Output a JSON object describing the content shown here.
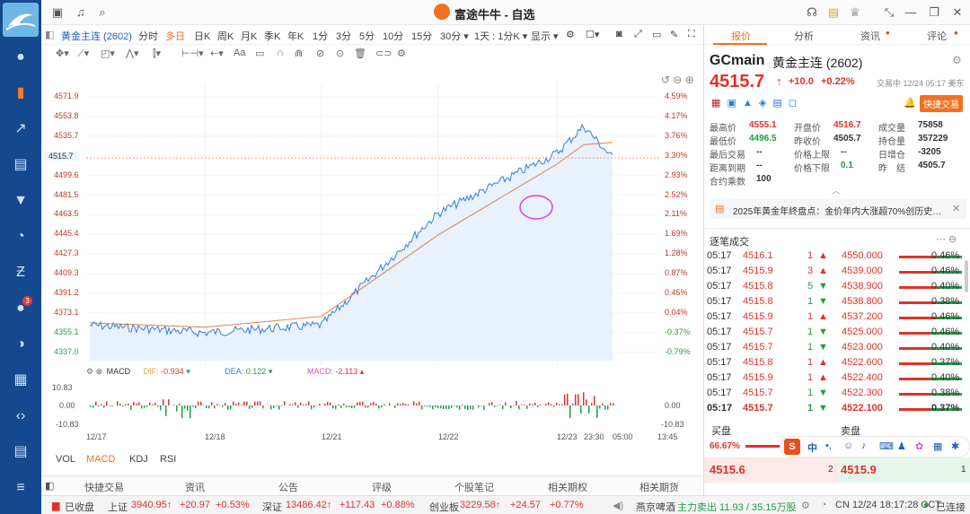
{
  "app": {
    "title": "富途牛牛 - 自选"
  },
  "sidebar": {
    "items": [
      "user-icon",
      "quote-icon",
      "chart-icon",
      "portfolio-icon",
      "market-icon",
      "pie-icon",
      "futures-icon",
      "message-icon",
      "news-icon",
      "game-icon",
      "code-icon",
      "doc-icon",
      "menu-icon"
    ],
    "badge": "3"
  },
  "toolbar": {
    "symbol": "黄金主连 (2602)",
    "periods": [
      "分时",
      "多日",
      "日K",
      "周K",
      "月K",
      "季K",
      "年K",
      "1分",
      "3分",
      "5分",
      "10分",
      "15分",
      "30分 ▾",
      "1天 : 1分K ▾",
      "显示 ▾"
    ],
    "active_period": "多日"
  },
  "chart": {
    "y_labels": [
      "4571.9",
      "4553.8",
      "4535.7",
      "4517.6",
      "4499.6",
      "4481.5",
      "4463.5",
      "4445.4",
      "4427.3",
      "4409.3",
      "4391.2",
      "4373.1",
      "4355.1",
      "4337.0"
    ],
    "pct_labels": [
      "4.59%",
      "4.17%",
      "3.76%",
      "3.30%",
      "2.93%",
      "2.52%",
      "2.11%",
      "1.69%",
      "1.28%",
      "0.87%",
      "0.45%",
      "0.04%",
      "-0.37%",
      "-0.79%"
    ],
    "current_price_label": "4515.7",
    "x_labels": [
      "12/17",
      "12/18",
      "12/21",
      "12/22",
      "12/23",
      "23:30",
      "05:00",
      "13:45"
    ]
  },
  "chart_data": {
    "type": "line",
    "title": "",
    "ylim": [
      4337.0,
      4571.9
    ],
    "series": [
      {
        "name": "",
        "x": [
          "12/17",
          "12/18",
          "12/21",
          "12/22",
          "12/23",
          "23:30",
          "05:00"
        ],
        "values": [
          4362,
          4355,
          4362,
          4465,
          4520,
          4545,
          4515.7
        ]
      },
      {
        "name": "",
        "x": [
          "12/17",
          "12/18",
          "12/21",
          "12/22",
          "12/23",
          "23:30",
          "05:00"
        ],
        "values": [
          4364,
          4360,
          4370,
          4445,
          4510,
          4528,
          4530
        ]
      }
    ]
  },
  "macd": {
    "label": "MACD",
    "dif_label": "DIF:",
    "dif": "-0.934",
    "dea_label": "DEA:",
    "dea": "0.122",
    "macd_label": "MACD:",
    "macd": "-2.113",
    "top": "10.83",
    "zero": "0.00",
    "bottom": "-10.83"
  },
  "indicators": [
    "VOL",
    "MACD",
    "KDJ",
    "RSI"
  ],
  "bottom_tabs": [
    "快捷交易",
    "资讯",
    "公告",
    "评级",
    "个股笔记",
    "相关期权",
    "相关期货"
  ],
  "status": {
    "closed": "已收盘",
    "idx1": {
      "name": "上证",
      "val": "3940.95↑",
      "chg": "+20.97",
      "pct": "+0.53%"
    },
    "idx2": {
      "name": "深证",
      "val": "13486.42↑",
      "chg": "+117.43",
      "pct": "+0.88%"
    },
    "idx3": {
      "name": "创业板",
      "val": "3229.58↑",
      "chg": "+24.57",
      "pct": "+0.77%"
    },
    "stock": "燕京啤酒",
    "flow": "主力卖出 11.93 / 35.15万股",
    "time": "CN 12/24 18:17:28 CCT",
    "conn": "已连接"
  },
  "right": {
    "tabs": [
      "报价",
      "分析",
      "资讯",
      "评论"
    ],
    "code": "GCmain",
    "name": "黄金主连 (2602)",
    "price": "4515.7",
    "arrow": "↑",
    "chg": "+10.0",
    "pct": "+0.22%",
    "trade_time": "交易中 12/24 05:17 美东",
    "quick_trade": "快捷交易",
    "stats": [
      [
        "最高价",
        "4555.1",
        "开盘价",
        "4516.7",
        "成交量",
        "75858"
      ],
      [
        "最低价",
        "4496.5",
        "昨收价",
        "4505.7",
        "持仓量",
        "357229"
      ],
      [
        "最后交易",
        "--",
        "价格上限",
        "--",
        "日增仓",
        "-3205"
      ],
      [
        "距离到期",
        "--",
        "价格下限",
        "0.1",
        "昨　结",
        "4505.7"
      ],
      [
        "合约乘数",
        "100",
        "",
        "",
        "",
        ""
      ]
    ],
    "news": "2025年黄金年终盘点：金价年内大涨超70%创历史…",
    "ticks_title": "逐笔成交",
    "ticks": [
      [
        "05:17",
        "4516.1",
        "1",
        "4550.000",
        "0.46%"
      ],
      [
        "05:17",
        "4515.9",
        "3",
        "4539.000",
        "0.46%"
      ],
      [
        "05:17",
        "4515.8",
        "5",
        "4538.900",
        "0.40%"
      ],
      [
        "05:17",
        "4515.8",
        "1",
        "4538.800",
        "0.38%"
      ],
      [
        "05:17",
        "4515.9",
        "1",
        "4537.200",
        "0.46%"
      ],
      [
        "05:17",
        "4515.7",
        "1",
        "4525.000",
        "0.46%"
      ],
      [
        "05:17",
        "4515.7",
        "1",
        "4523.000",
        "0.40%"
      ],
      [
        "05:17",
        "4515.8",
        "1",
        "4522.600",
        "0.37%"
      ],
      [
        "05:17",
        "4515.9",
        "1",
        "4522.400",
        "0.40%"
      ],
      [
        "05:17",
        "4515.7",
        "1",
        "4522.300",
        "0.38%"
      ],
      [
        "05:17",
        "4515.7",
        "1",
        "4522.100",
        "0.37%"
      ]
    ],
    "tick_dirs": [
      "up",
      "up",
      "down",
      "down",
      "up",
      "down",
      "down",
      "up",
      "up",
      "down",
      "down"
    ],
    "bid_label": "买盘",
    "ask_label": "卖盘",
    "bid_pct": "66.67%",
    "bid": "4515.6",
    "bid_size": "2",
    "ask": "4515.9",
    "ask_size": "1",
    "ime": "中"
  }
}
